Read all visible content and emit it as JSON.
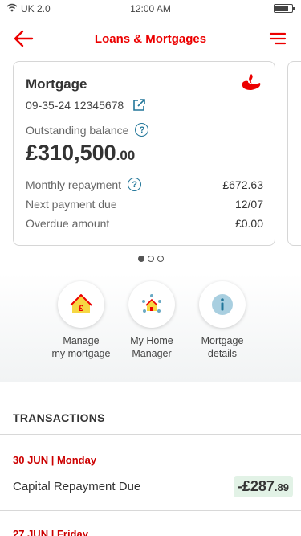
{
  "status_bar": {
    "carrier": "UK 2.0",
    "time": "12:00 AM",
    "battery_level": 0.8,
    "icons": [
      "wifi-icon",
      "battery-icon"
    ]
  },
  "header": {
    "title": "Loans & Mortgages",
    "icons": [
      "back-arrow-icon",
      "menu-icon"
    ]
  },
  "card": {
    "title": "Mortgage",
    "account_number": "09-35-24 12345678",
    "balance_label": "Outstanding balance",
    "balance_main": "£310,500",
    "balance_pence": ".00",
    "monthly_label": "Monthly repayment",
    "monthly_value": "£672.63",
    "next_label": "Next payment due",
    "next_value": "12/07",
    "overdue_label": "Overdue amount",
    "overdue_value": "£0.00",
    "icons": [
      "santander-flame-logo",
      "external-link-icon",
      "info-icon"
    ]
  },
  "pagination": {
    "total": 3,
    "active_index": 0
  },
  "actions": [
    {
      "label": "Manage\nmy mortgage",
      "icon": "house-pound-icon"
    },
    {
      "label": "My Home\nManager",
      "icon": "home-network-icon"
    },
    {
      "label": "Mortgage\ndetails",
      "icon": "info-icon"
    }
  ],
  "transactions": {
    "heading": "TRANSACTIONS",
    "groups": [
      {
        "date": "30 JUN | Monday",
        "items": [
          {
            "description": "Capital Repayment Due",
            "amount_main": "-£287",
            "amount_pence": ".89"
          }
        ]
      },
      {
        "date": "27 JUN | Friday",
        "items": []
      }
    ]
  },
  "colors": {
    "brand_red": "#ec0000",
    "date_red": "#cc0000",
    "info_teal": "#23779a",
    "amount_bg": "#e2f2e6",
    "house_yellow": "#f6d743"
  }
}
